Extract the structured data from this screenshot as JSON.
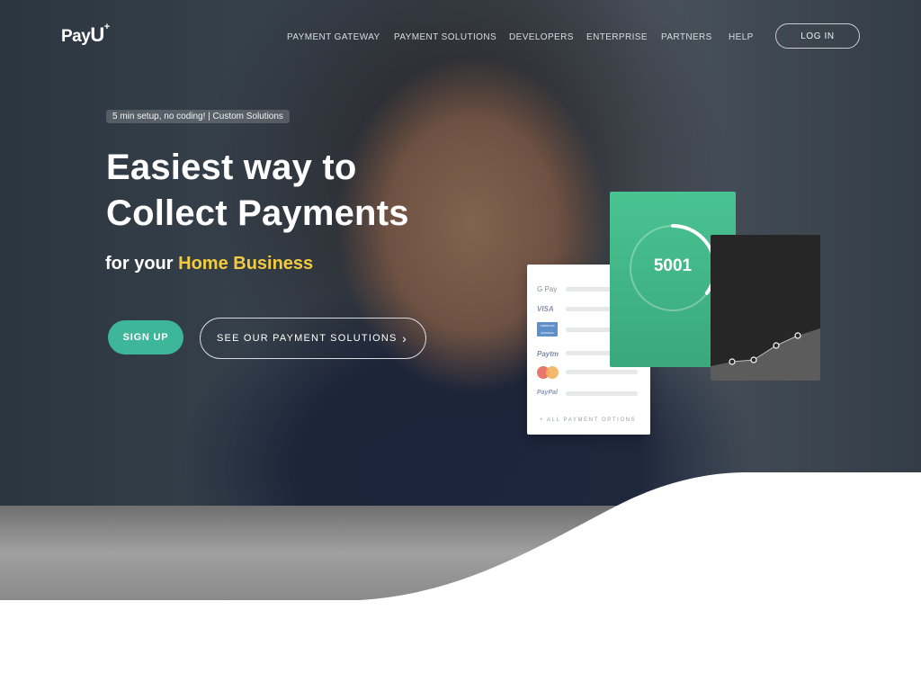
{
  "brand": {
    "logo_text": "Pay",
    "logo_u": "U",
    "logo_mark": "+"
  },
  "nav": {
    "items": [
      "PAYMENT GATEWAY",
      "PAYMENT SOLUTIONS",
      "DEVELOPERS",
      "ENTERPRISE",
      "PARTNERS",
      "HELP"
    ],
    "login_label": "LOG IN"
  },
  "hero": {
    "badge": "5 min setup, no coding! | Custom Solutions",
    "heading_line1": "Easiest way to",
    "heading_line2": "Collect Payments",
    "sub_prefix": "for your",
    "sub_highlight": "Home Business",
    "signup_label": "SIGN UP",
    "solutions_label": "SEE OUR PAYMENT SOLUTIONS",
    "solutions_chevron": "›"
  },
  "payment_card": {
    "methods": [
      "G Pay",
      "VISA",
      "AMERICAN EXPRESS",
      "Paytm",
      "Mastercard",
      "PayPal"
    ],
    "footer": "+ ALL PAYMENT OPTIONS"
  },
  "stats_card": {
    "value": "5001",
    "progress": 0.35
  },
  "colors": {
    "accent": "#3db699",
    "highlight": "#f2cc3c",
    "green_card": "#49c391"
  },
  "icons": {
    "chevron": "chevron-right-icon"
  }
}
